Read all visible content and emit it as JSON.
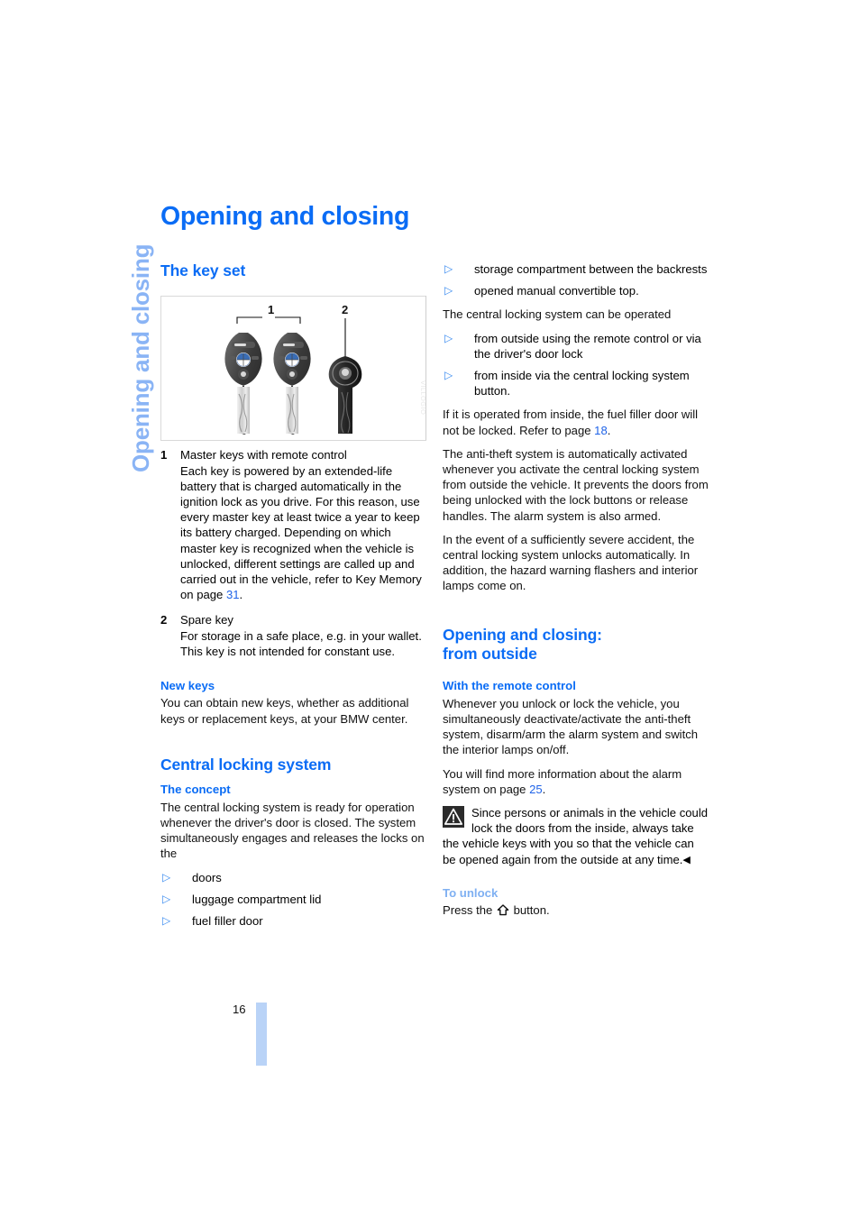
{
  "chapter": {
    "title": "Opening and closing",
    "side_tab": "Opening and closing"
  },
  "figure": {
    "code": "VILLOGIO",
    "callout_1": "1",
    "callout_2": "2",
    "alt": "two BMW master keys with remote control and one flat spare key"
  },
  "left_column": {
    "section_key_set": "The key set",
    "legend": [
      {
        "num": "1",
        "title": "Master keys with remote control",
        "body_1": "Each key is powered by an extended-life battery that is charged automatically in the ignition lock as you drive. For this reason, use every master key at least twice a year to keep its battery charged. Depending on which master key is recognized when the vehicle is unlocked, different settings are called up and carried out in the vehicle, refer to Key Memory on page ",
        "body_link": "31",
        "body_2": "."
      },
      {
        "num": "2",
        "title": "Spare key",
        "body_1": "For storage in a safe place, e.g. in your wallet.",
        "body_2": "This key is not intended for constant use."
      }
    ],
    "sub_new_keys": "New keys",
    "new_keys_body": "You can obtain new keys, whether as additional keys or replacement keys, at your BMW center.",
    "section_central_locking": "Central locking system",
    "sub_concept": "The concept",
    "concept_body": "The central locking system is ready for operation whenever the driver's door is closed. The system simultaneously engages and releases the locks on the",
    "concept_list": [
      "doors",
      "luggage compartment lid",
      "fuel filler door"
    ]
  },
  "right_column": {
    "concept_list_continued": [
      "storage compartment between the backrests",
      "opened manual convertible top."
    ],
    "operated_intro": "The central locking system can be operated",
    "operated_list": [
      "from outside using the remote control or via the driver's door lock",
      "from inside via the central locking system button."
    ],
    "inside_note_1": "If it is operated from inside, the fuel filler door will not be locked. Refer to page ",
    "inside_note_link": "18",
    "inside_note_2": ".",
    "antitheft_body": "The anti-theft system is automatically activated whenever you activate the central locking system from outside the vehicle. It prevents the doors from being unlocked with the lock buttons or release handles. The alarm system is also armed.",
    "accident_body": "In the event of a sufficiently severe accident, the central locking system unlocks automatically. In addition, the hazard warning flashers and interior lamps come on.",
    "section_from_outside_line1": "Opening and closing:",
    "section_from_outside_line2": "from outside",
    "sub_remote_control": "With the remote control",
    "remote_body": "Whenever you unlock or lock the vehicle, you simultaneously deactivate/activate the anti-theft system, disarm/arm the alarm system and switch the interior lamps on/off.",
    "alarm_info_1": "You will find more information about the alarm system on page ",
    "alarm_info_link": "25",
    "alarm_info_2": ".",
    "warning_text": "Since persons or animals in the vehicle could lock the doors from the inside, always take the vehicle keys with you so that the vehicle can be opened again from the outside at any time.",
    "warning_end_mark": "◀",
    "sub_to_unlock": "To unlock",
    "to_unlock_before": "Press the ",
    "to_unlock_after": " button."
  },
  "footer": {
    "page_number": "16"
  },
  "colors": {
    "heading_blue": "#0a6cf5",
    "tint_blue": "#8ab4f5",
    "link_blue": "#1f63e8",
    "bullet_blue": "#3b8cf0",
    "page_bar": "#b9d3f7"
  },
  "icons": {
    "bullet": "triangle-right-icon",
    "warning": "warning-triangle-icon",
    "unlock": "unlock-arrow-icon"
  }
}
